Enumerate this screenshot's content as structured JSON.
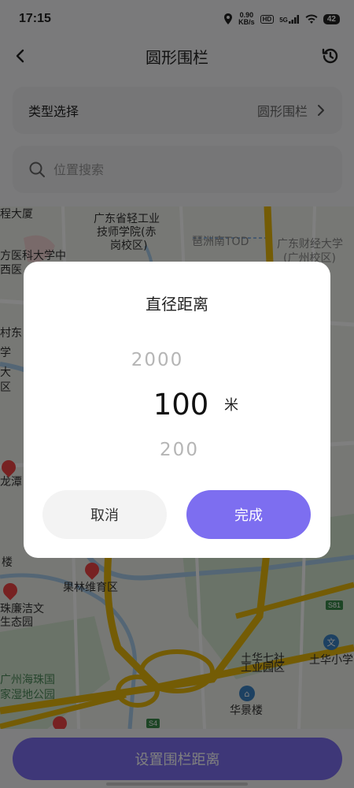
{
  "status_bar": {
    "time": "17:15",
    "net_speed_value": "0.90",
    "net_speed_unit": "KB/s",
    "hd": "HD",
    "signal": "5G",
    "battery": "42"
  },
  "header": {
    "title": "圆形围栏",
    "back_icon": "chevron-left-icon",
    "history_icon": "history-icon"
  },
  "type_select": {
    "label": "类型选择",
    "value": "圆形围栏"
  },
  "search": {
    "placeholder": "位置搜索",
    "value": ""
  },
  "map": {
    "labels": [
      "程大厦",
      "广东省轻工业",
      "技师学院(赤",
      "岗校区)",
      "琶洲南TOD",
      "广东财经大学",
      "(广州校区)",
      "方医科大学中",
      "西医",
      "村东",
      "学",
      "大",
      "区",
      "龙潭",
      "楼",
      "果林维育区",
      "珠廉洁文",
      "生态园",
      "广州海珠国",
      "家湿地公园",
      "土华七社",
      "工业园区",
      "土华小学",
      "华景楼"
    ],
    "road_tags": [
      "S81",
      "S4"
    ],
    "accent_road_color": "#e8b80a"
  },
  "dialog": {
    "title": "直径距离",
    "picker": {
      "prev": "2000",
      "selected": "100",
      "next": "200",
      "unit": "米"
    },
    "cancel_label": "取消",
    "done_label": "完成"
  },
  "bottom": {
    "set_distance_label": "设置围栏距离"
  },
  "colors": {
    "accent": "#7d6ef0",
    "overlay": "rgba(0,0,0,0.5)"
  }
}
